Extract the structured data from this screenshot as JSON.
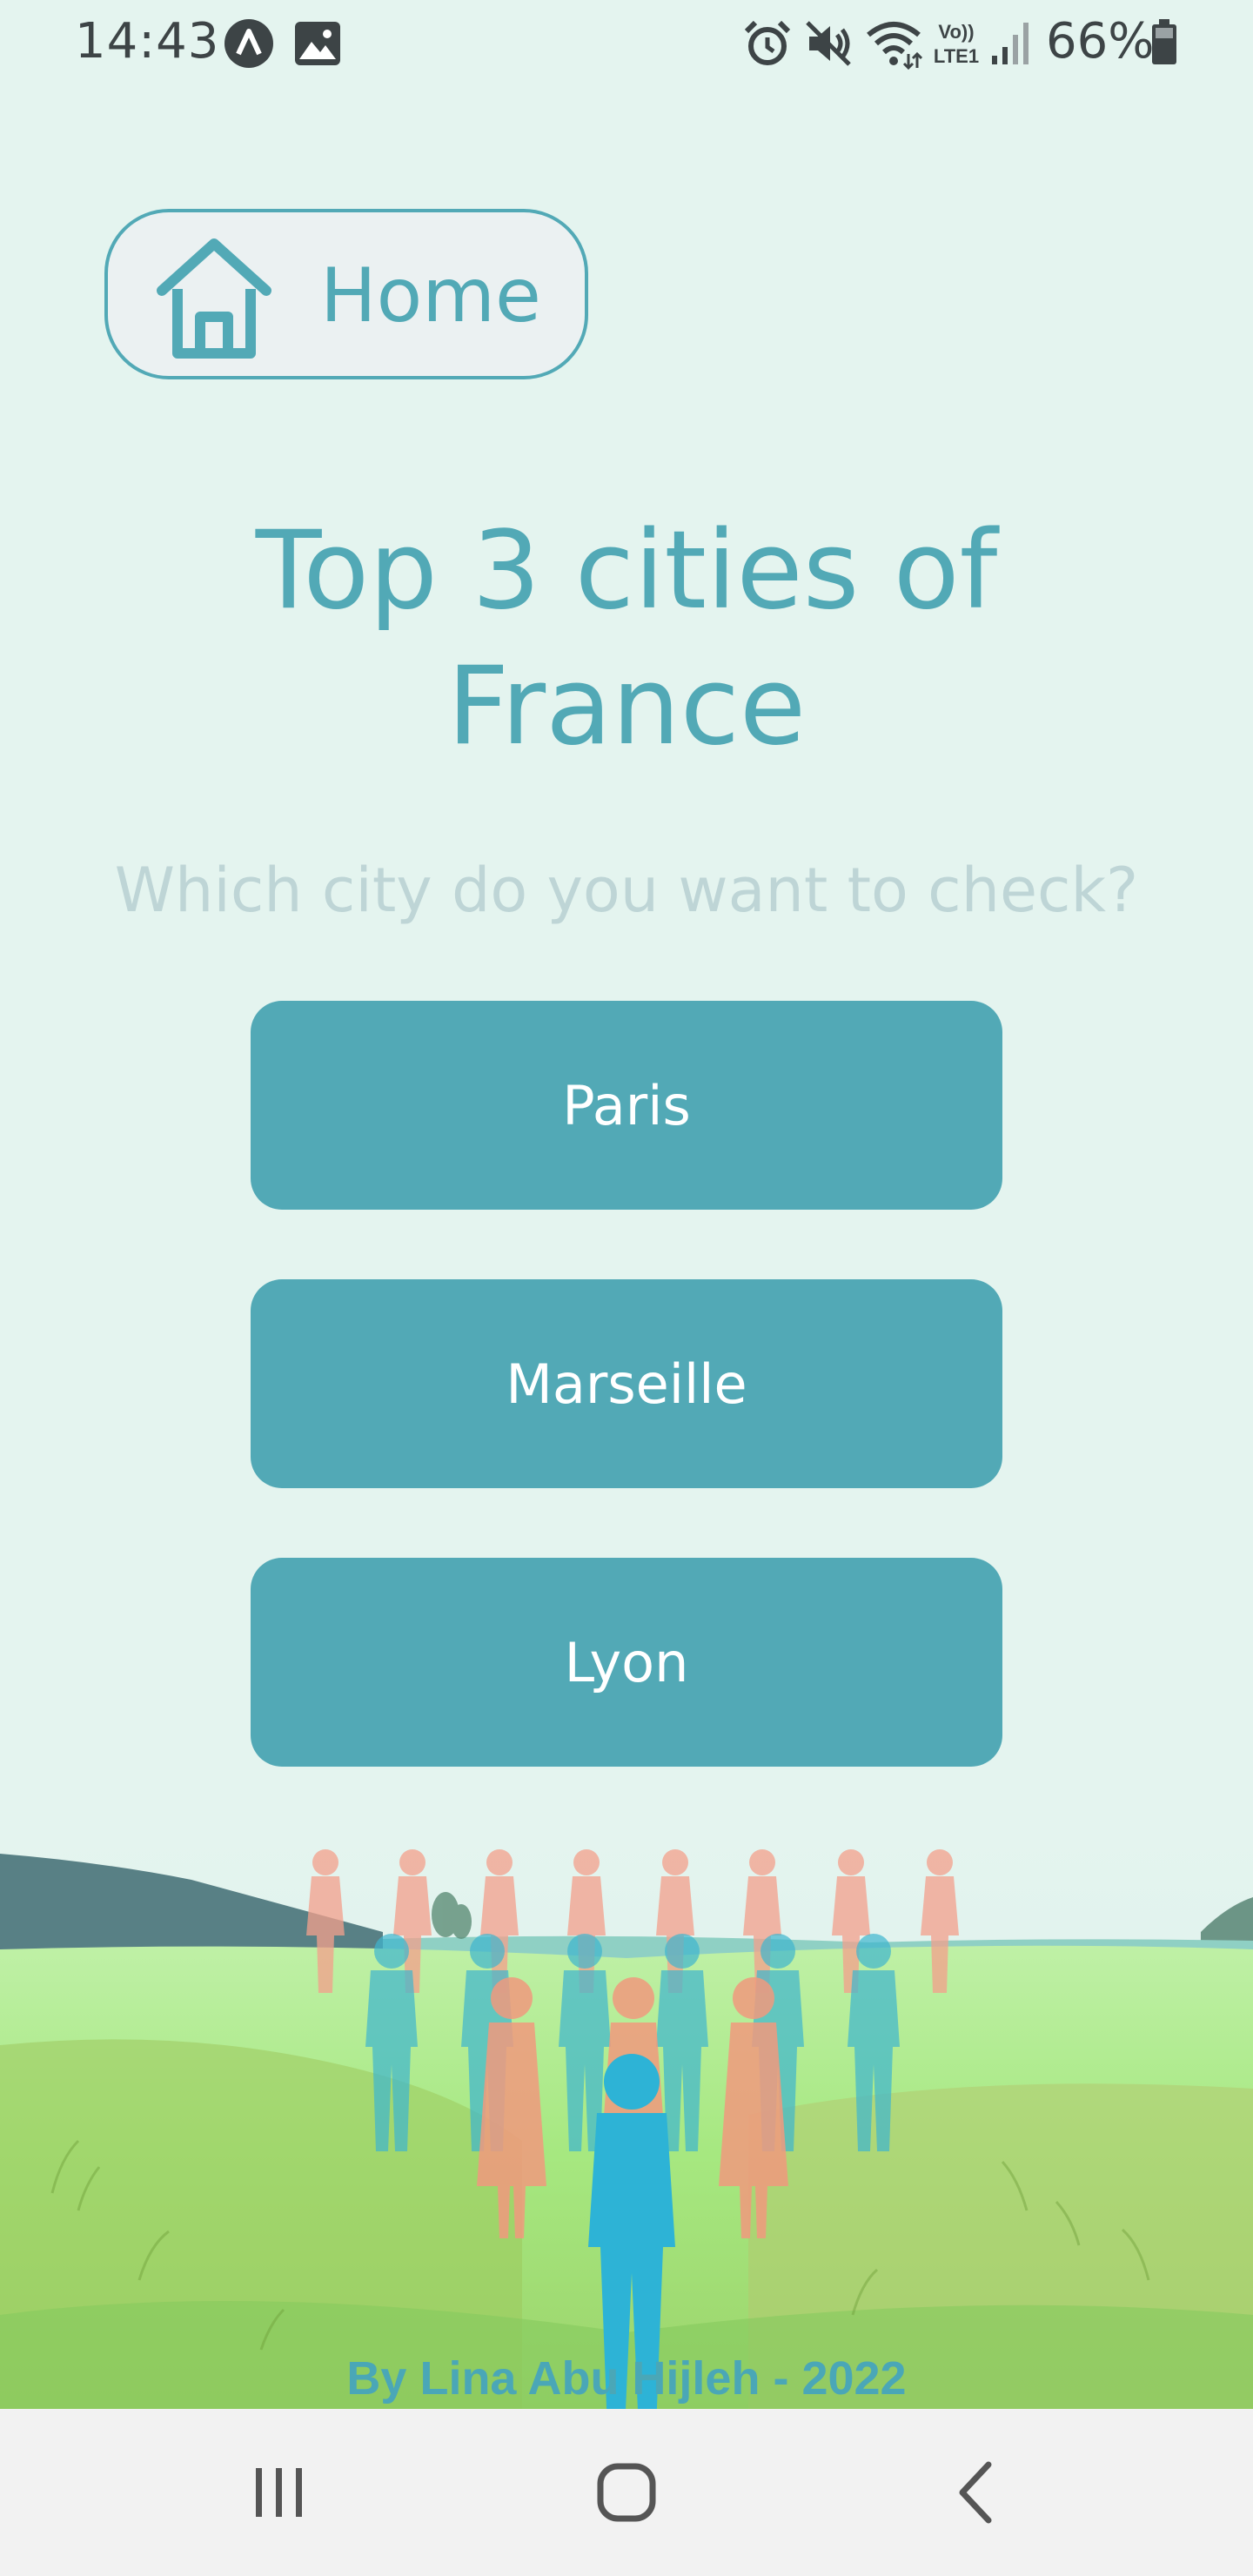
{
  "status_bar": {
    "time": "14:43",
    "battery": "66%",
    "icons_left": [
      "app-notification-icon",
      "gallery-icon"
    ],
    "icons_right": [
      "alarm-icon",
      "mute-icon",
      "wifi-icon",
      "volte-icon",
      "signal-icon",
      "battery-icon"
    ],
    "volte_label": "Vo)) LTE1"
  },
  "header": {
    "home_label": "Home",
    "home_icon": "home-icon"
  },
  "main": {
    "title": "Top 3 cities of France",
    "subtitle": "Which city do you want to check?",
    "cities": [
      {
        "label": "Paris"
      },
      {
        "label": "Marseille"
      },
      {
        "label": "Lyon"
      }
    ]
  },
  "footer": {
    "credit": "By Lina Abu Hijleh - 2022"
  },
  "nav_bar": {
    "items": [
      "recents-icon",
      "home-circle-icon",
      "back-icon"
    ]
  },
  "colors": {
    "background": "#e4f4ef",
    "accent": "#52a9b6",
    "subtitle": "#bed5d6",
    "button_text": "#ffffff",
    "nav_background": "#f2f2f2"
  }
}
